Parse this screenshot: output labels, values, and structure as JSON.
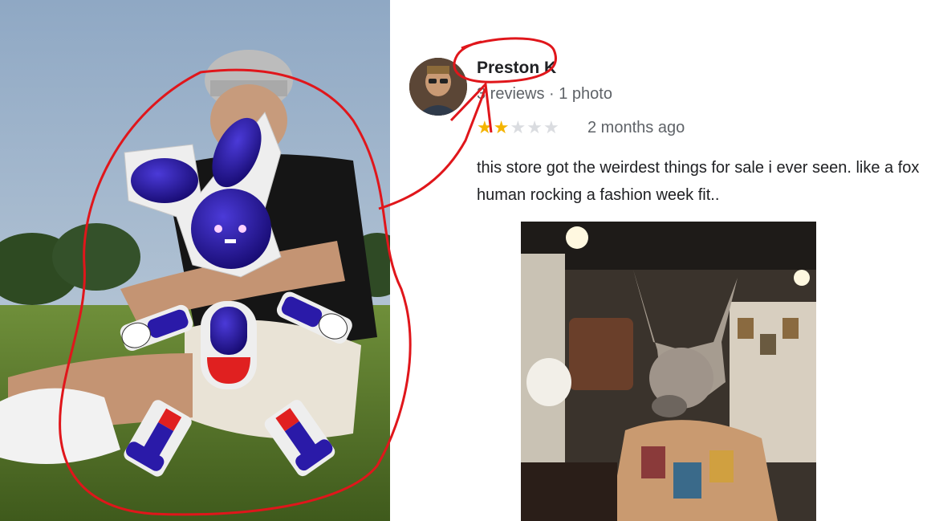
{
  "review": {
    "reviewer_name": "Preston K",
    "reviews_meta": "3 reviews · 1 photo",
    "rating": 2,
    "rating_max": 5,
    "time_ago": "2 months ago",
    "text": "this store got the weirdest things for sale i ever seen. like a fox human rocking a fashion week fit.."
  },
  "colors": {
    "annotation": "#e0161b",
    "sticker_blue": "#2a1aa8",
    "sticker_red": "#e02020",
    "star": "#f4b400"
  },
  "icons": [
    "star-icon",
    "bunny-sticker-icon"
  ]
}
